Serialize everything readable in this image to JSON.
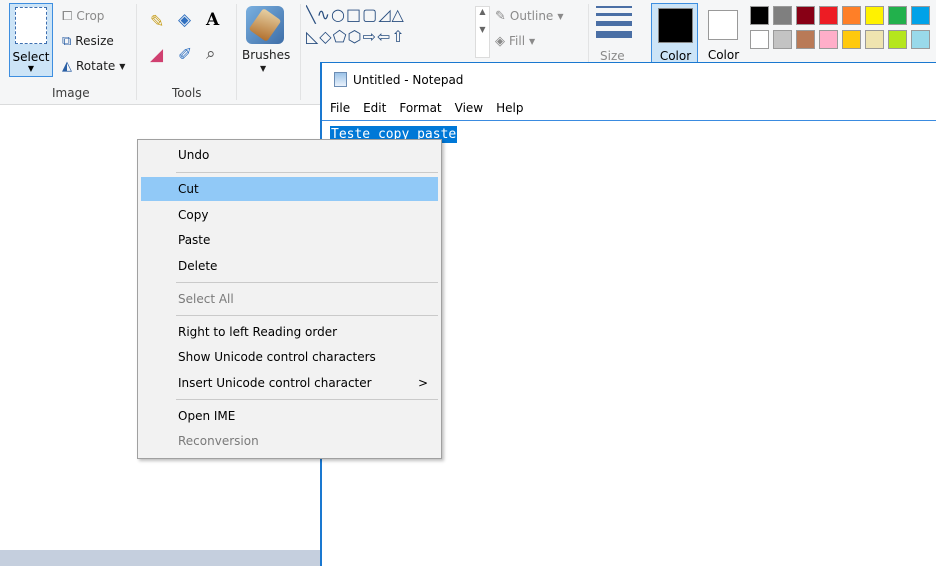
{
  "paint": {
    "image_group": {
      "label": "Image",
      "select_label": "Select",
      "crop_label": "Crop",
      "resize_label": "Resize",
      "rotate_label": "Rotate"
    },
    "tools_group": {
      "label": "Tools"
    },
    "brushes_label": "Brushes",
    "shapes": {
      "row1": "╲∿○□▢◿△",
      "row2": "◺◇⬠⬡⇨⇦⇧",
      "outline_label": "Outline",
      "fill_label": "Fill"
    },
    "size_label": "Size",
    "color1_label": "Color",
    "color2_label": "Color",
    "palette_row1": [
      "#000000",
      "#7f7f7f",
      "#880015",
      "#ed1c24",
      "#ff7f27",
      "#fff200",
      "#22b14c",
      "#00a2e8"
    ],
    "palette_row2": [
      "#ffffff",
      "#c3c3c3",
      "#b97a57",
      "#ffaec9",
      "#ffc90e",
      "#efe4b0",
      "#b5e61d",
      "#99d9ea"
    ]
  },
  "notepad": {
    "title": "Untitled - Notepad",
    "menu": [
      "File",
      "Edit",
      "Format",
      "View",
      "Help"
    ],
    "selected_text": "Teste copy paste"
  },
  "context_menu": {
    "items": [
      {
        "label": "Undo",
        "state": "normal"
      },
      {
        "label": "Cut",
        "state": "highlighted"
      },
      {
        "label": "Copy",
        "state": "normal"
      },
      {
        "label": "Paste",
        "state": "normal"
      },
      {
        "label": "Delete",
        "state": "normal"
      },
      {
        "label": "Select All",
        "state": "disabled"
      },
      {
        "label": "Right to left Reading order",
        "state": "normal"
      },
      {
        "label": "Show Unicode control characters",
        "state": "normal"
      },
      {
        "label": "Insert Unicode control character",
        "state": "normal",
        "submenu_arrow": ">"
      },
      {
        "label": "Open IME",
        "state": "normal"
      },
      {
        "label": "Reconversion",
        "state": "disabled"
      }
    ]
  },
  "colors": {
    "accent": "#0078d7",
    "menu_highlight": "#91c9f7"
  }
}
